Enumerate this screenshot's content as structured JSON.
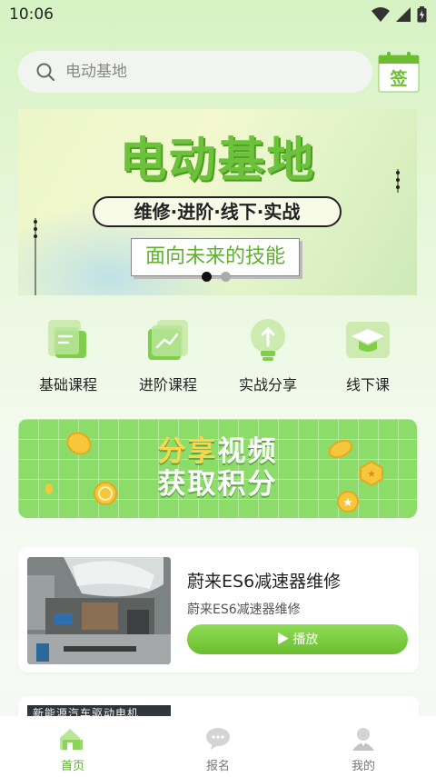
{
  "status_bar": {
    "time": "10:06"
  },
  "search": {
    "placeholder": "电动基地"
  },
  "sign_in": {
    "label": "签"
  },
  "banner": {
    "title": "电动基地",
    "tagline": "维修·进阶·线下·实战",
    "slogan": "面向未来的技能",
    "dots_count": 2,
    "active_dot": 0
  },
  "quick_nav": [
    {
      "label": "基础课程",
      "icon": "document-icon"
    },
    {
      "label": "进阶课程",
      "icon": "trend-chart-icon"
    },
    {
      "label": "实战分享",
      "icon": "lightbulb-icon"
    },
    {
      "label": "线下课",
      "icon": "graduation-cap-icon"
    }
  ],
  "share_banner": {
    "line1_highlight": "分享",
    "line1_rest": "视频",
    "line2": "获取积分"
  },
  "courses": [
    {
      "title": "蔚来ES6减速器维修",
      "subtitle": "蔚来ES6减速器维修",
      "play_label": "▶ 播放"
    },
    {
      "thumb_text": "新能源汽车驱动电机"
    }
  ],
  "tabs": [
    {
      "label": "首页",
      "icon": "home-icon",
      "active": true
    },
    {
      "label": "报名",
      "icon": "chat-bubble-icon",
      "active": false
    },
    {
      "label": "我的",
      "icon": "user-icon",
      "active": false
    }
  ],
  "colors": {
    "accent": "#6bbe2f",
    "banner_title": "#6cc23a",
    "tab_active": "#5fb130"
  }
}
